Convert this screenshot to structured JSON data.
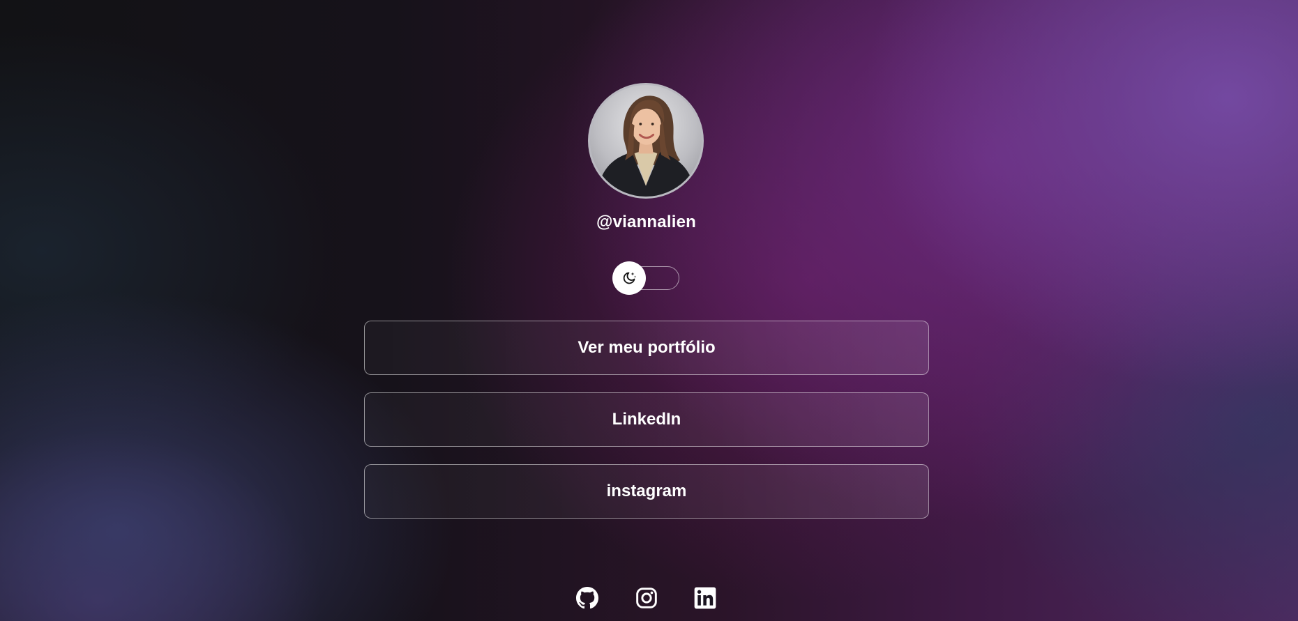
{
  "profile": {
    "avatar_alt": "profile photo",
    "username": "@viannalien"
  },
  "theme_toggle": {
    "icon": "moon-stars-icon",
    "state": "dark"
  },
  "links": [
    {
      "label": "Ver meu portfólio"
    },
    {
      "label": "LinkedIn"
    },
    {
      "label": "instagram"
    }
  ],
  "social_icons": [
    {
      "icon": "github-icon"
    },
    {
      "icon": "instagram-icon"
    },
    {
      "icon": "linkedin-icon"
    }
  ],
  "colors": {
    "text": "#ffffff",
    "background_dark": "#121215",
    "accent_purple": "#6b3a8a",
    "button_border": "#9e8ea8"
  }
}
